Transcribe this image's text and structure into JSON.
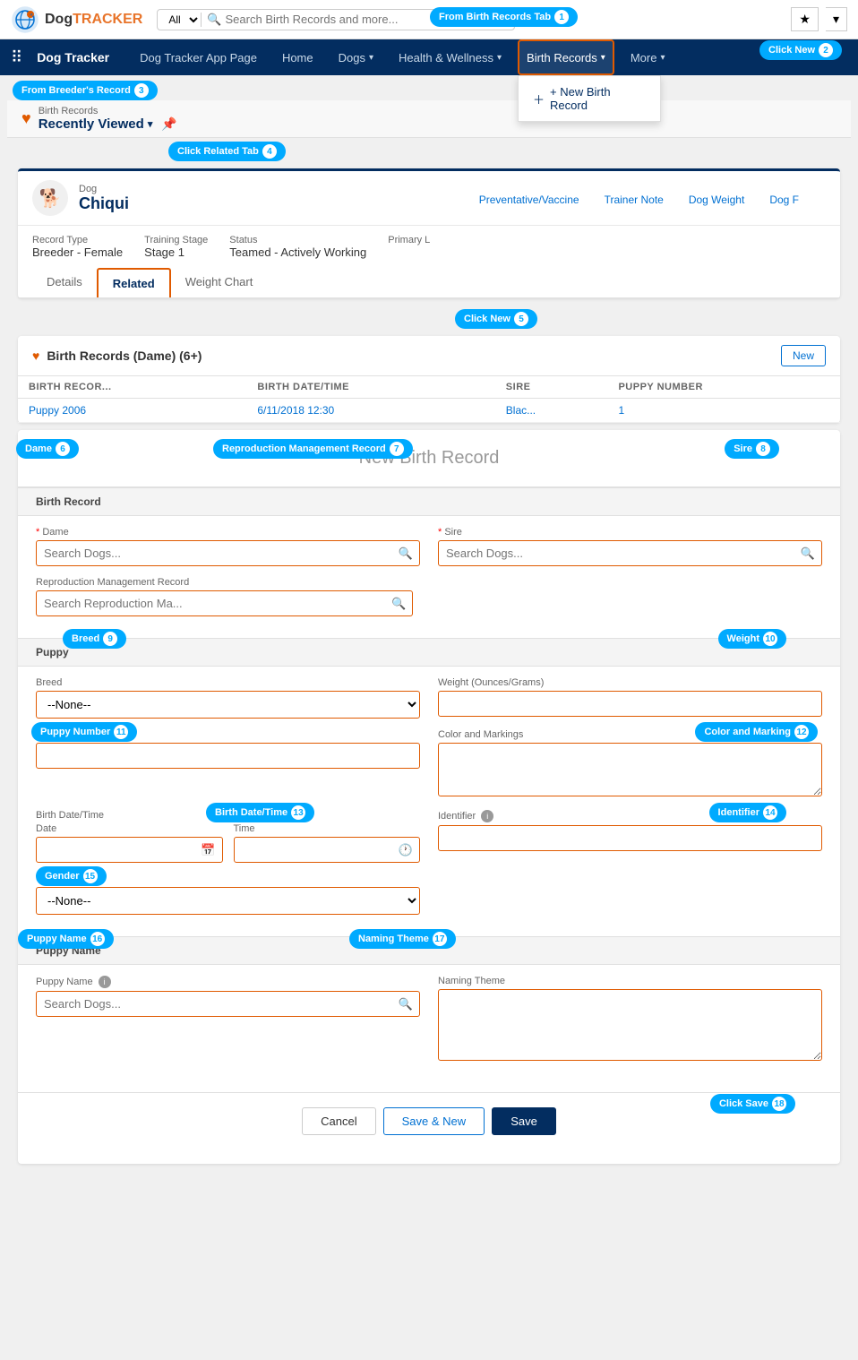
{
  "callouts": {
    "c1": "From Birth Records Tab",
    "c2": "Click New",
    "c3": "From Breeder's Record",
    "c4": "Click Related Tab",
    "c5": "Click New",
    "c6": "Dame",
    "c7": "Reproduction Management Record",
    "c8": "Sire",
    "c9": "Breed",
    "c10": "Weight",
    "c11": "Puppy Number",
    "c12": "Color and Marking",
    "c13": "Birth Date/Time",
    "c14": "Identifier",
    "c15": "Gender",
    "c16": "Puppy Name",
    "c17": "Naming Theme",
    "c18": "Click Save"
  },
  "topNav": {
    "searchPlaceholder": "Search Birth Records and more...",
    "allLabel": "All",
    "appTitle": "Dog Tracker"
  },
  "appNav": {
    "items": [
      {
        "label": "Dog Tracker App Page",
        "active": false
      },
      {
        "label": "Home",
        "active": false
      },
      {
        "label": "Dogs",
        "active": false,
        "hasChevron": true
      },
      {
        "label": "Health & Wellness",
        "active": false,
        "hasChevron": true
      },
      {
        "label": "Birth Records",
        "active": true,
        "hasChevron": true
      },
      {
        "label": "More",
        "active": false,
        "hasChevron": true
      }
    ]
  },
  "breadcrumb": {
    "path": "Birth Records",
    "title": "Recently Viewed"
  },
  "dogCard": {
    "name": "Chiqui",
    "recordType": "Breeder - Female",
    "trainingStage": "Stage 1",
    "status": "Teamed - Actively Working",
    "tabs": [
      "Details",
      "Related",
      "Weight Chart"
    ],
    "scrollTabs": [
      "Preventative/Vaccine",
      "Trainer Note",
      "Dog Weight",
      "Dog F"
    ]
  },
  "relatedSection": {
    "title": "Birth Records (Dame) (6+)",
    "newLabel": "New",
    "columns": [
      "BIRTH RECOR...",
      "BIRTH DATE/TIME",
      "SIRE",
      "PUPPY NUMBER"
    ],
    "rows": [
      {
        "name": "Puppy 2006",
        "date": "6/11/2018 12:30",
        "sire": "Blac...",
        "number": "1"
      }
    ]
  },
  "form": {
    "title": "New Birth Record",
    "sections": {
      "birthRecord": {
        "label": "Birth Record",
        "dameLabel": "Dame",
        "damePlaceholder": "Search Dogs...",
        "sireLabel": "Sire",
        "sirePlaceholder": "Search Dogs...",
        "reproLabel": "Reproduction Management Record",
        "reproPlaceholder": "Search Reproduction Ma..."
      },
      "puppy": {
        "label": "Puppy",
        "breedLabel": "Breed",
        "breedDefault": "--None--",
        "weightLabel": "Weight (Ounces/Grams)",
        "puppyNumLabel": "Puppy Number",
        "colorLabel": "Color and Markings",
        "birthDateLabel": "Birth Date/Time",
        "dateLabel": "Date",
        "timeLabel": "Time",
        "identifierLabel": "Identifier",
        "genderLabel": "Gender",
        "genderDefault": "--None--"
      },
      "puppyName": {
        "label": "Puppy Name",
        "puppyNameLabel": "Puppy Name",
        "puppyNamePlaceholder": "Search Dogs...",
        "namingThemeLabel": "Naming Theme"
      }
    },
    "footer": {
      "cancelLabel": "Cancel",
      "saveNewLabel": "Save & New",
      "saveLabel": "Save"
    }
  },
  "navDropdown": {
    "items": [
      {
        "label": "+ New Birth Record"
      }
    ]
  }
}
